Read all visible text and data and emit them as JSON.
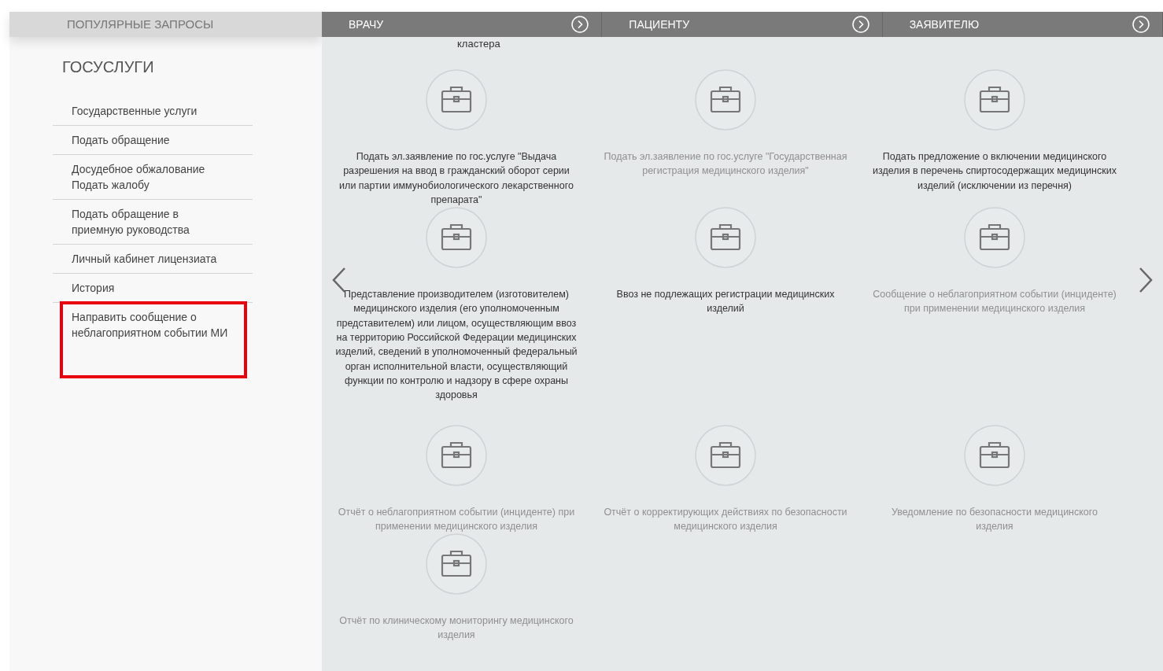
{
  "sidebar": {
    "tab": "ПОПУЛЯРНЫЕ ЗАПРОСЫ",
    "title": "ГОСУСЛУГИ",
    "items": [
      {
        "label": "Государственные услуги",
        "highlighted": false
      },
      {
        "label": "Подать обращение",
        "highlighted": false
      },
      {
        "label": "Досудебное обжалование\nПодать жалобу",
        "highlighted": false
      },
      {
        "label": "Подать обращение в\nприемную руководства",
        "highlighted": false
      },
      {
        "label": "Личный кабинет лицензиата",
        "highlighted": false
      },
      {
        "label": "История",
        "highlighted": false
      },
      {
        "label": "Направить сообщение о\nнеблагоприятном событии МИ",
        "highlighted": true
      }
    ]
  },
  "tabs": [
    {
      "label": "ВРАЧУ"
    },
    {
      "label": "ПАЦИЕНТУ"
    },
    {
      "label": "ЗАЯВИТЕЛЮ"
    }
  ],
  "carousel": {
    "cut_text": "кластера",
    "services": [
      {
        "label": "Подать эл.заявление по гос.услуге \"Выдача разрешения на ввод в гражданский оборот серии или партии иммунобиологического лекарственного препарата\"",
        "muted": false
      },
      {
        "label": "Подать эл.заявление по гос.услуге \"Государственная регистрация медицинского изделия\"",
        "muted": true
      },
      {
        "label": "Подать предложение о включении медицинского изделия в перечень спиртосодержащих медицинских изделий (исключении из перечня)",
        "muted": false
      },
      {
        "label": "Представление производителем (изготовителем) медицинского изделия (его уполномоченным представителем) или лицом, осуществляющим ввоз на территорию Российской Федерации медицинских изделий, сведений в уполномоченный федеральный орган исполнительной власти, осуществляющий функции по контролю и надзору в сфере охраны здоровья",
        "muted": false
      },
      {
        "label": "Ввоз не подлежащих регистрации медицинских изделий",
        "muted": false
      },
      {
        "label": "Сообщение о неблагоприятном событии (инциденте) при применении медицинского изделия",
        "muted": true
      },
      {
        "label": "Отчёт о неблагоприятном событии (инциденте) при применении медицинского изделия",
        "muted": true
      },
      {
        "label": "Отчёт о корректирующих действиях по безопасности медицинского изделия",
        "muted": true
      },
      {
        "label": "Уведомление по безопасности медицинского изделия",
        "muted": true
      },
      {
        "label": "Отчёт по клиническому мониторингу медицинского изделия",
        "muted": true
      }
    ]
  }
}
